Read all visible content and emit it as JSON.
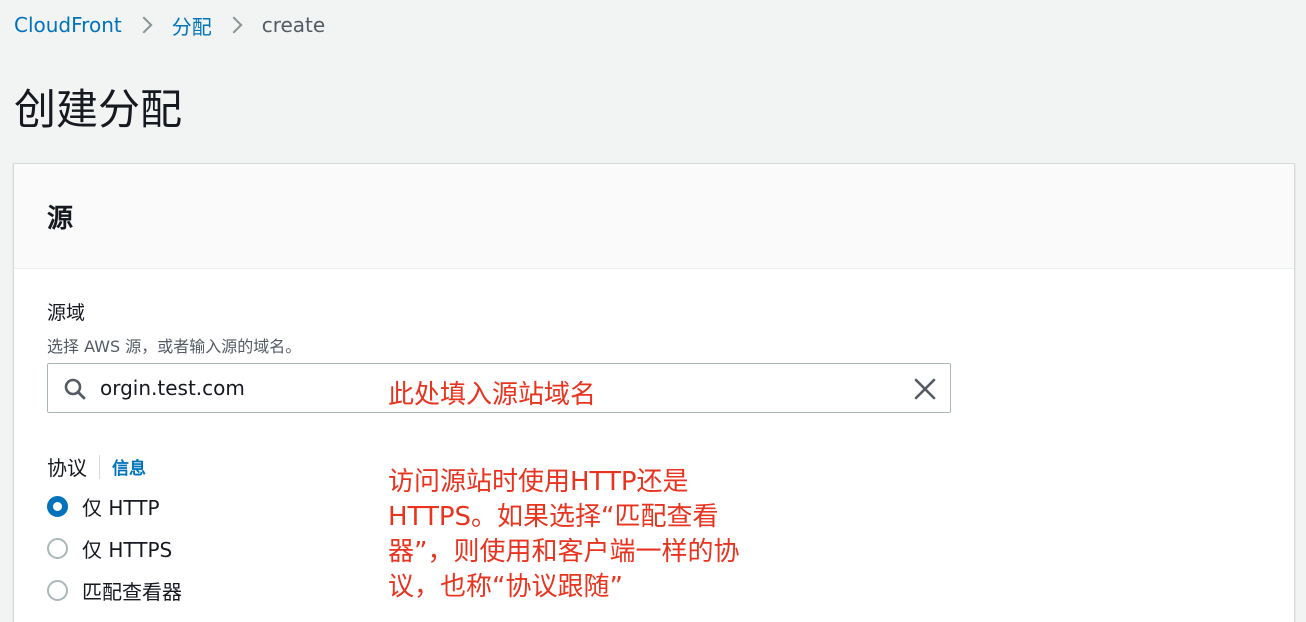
{
  "breadcrumb": {
    "items": [
      "CloudFront",
      "分配"
    ],
    "current": "create"
  },
  "page": {
    "title": "创建分配"
  },
  "origin_panel": {
    "heading": "源",
    "domain_field": {
      "label": "源域",
      "description": "选择 AWS 源，或者输入源的域名。",
      "value": "orgin.test.com"
    },
    "protocol": {
      "label": "协议",
      "info_link": "信息",
      "options": [
        "仅 HTTP",
        "仅 HTTPS",
        "匹配查看器"
      ],
      "selected_index": 0
    }
  },
  "annotations": {
    "domain_note": "此处填入源站域名",
    "protocol_note": "访问源站时使用HTTP还是HTTPS。如果选择“匹配查看器”，则使用和客户端一样的协议，也称“协议跟随”"
  },
  "colors": {
    "link": "#0073bb",
    "annotation": "#e8331f",
    "background": "#f2f3f3"
  }
}
